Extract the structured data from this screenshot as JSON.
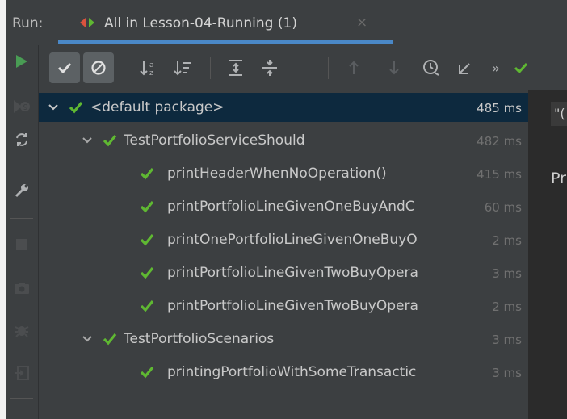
{
  "run_bar": {
    "label": "Run:",
    "tab_title": "All in Lesson-04-Running (1)",
    "tab_close": "×",
    "accent": "#4a88c7"
  },
  "toolbar": {
    "items": [
      "show-passed",
      "show-ignored",
      "sort-alphabetically",
      "sort-by-duration",
      "expand-all",
      "collapse-all",
      "previous-failed",
      "next-failed",
      "test-history",
      "import-tests",
      "more"
    ],
    "overflow": "»"
  },
  "tree": {
    "rows": [
      {
        "label": "<default package>",
        "time": "485 ms"
      },
      {
        "label": "TestPortfolioServiceShould",
        "time": "482 ms"
      },
      {
        "label": "printHeaderWhenNoOperation()",
        "time": "415 ms"
      },
      {
        "label": "printPortfolioLineGivenOneBuyAndC",
        "time": "60 ms"
      },
      {
        "label": "printOnePortfolioLineGivenOneBuyO",
        "time": "2 ms"
      },
      {
        "label": "printPortfolioLineGivenTwoBuyOpera",
        "time": "3 ms"
      },
      {
        "label": "printPortfolioLineGivenTwoBuyOpera",
        "time": "2 ms"
      },
      {
        "label": "TestPortfolioScenarios",
        "time": "3 ms"
      },
      {
        "label": "printingPortfolioWithSomeTransactic",
        "time": "3 ms"
      }
    ]
  },
  "console": {
    "line1": "\"(",
    "line2": "Pr"
  },
  "colors": {
    "pass_green": "#5fb832",
    "run_green": "#499c54",
    "selection": "#0d293e"
  }
}
